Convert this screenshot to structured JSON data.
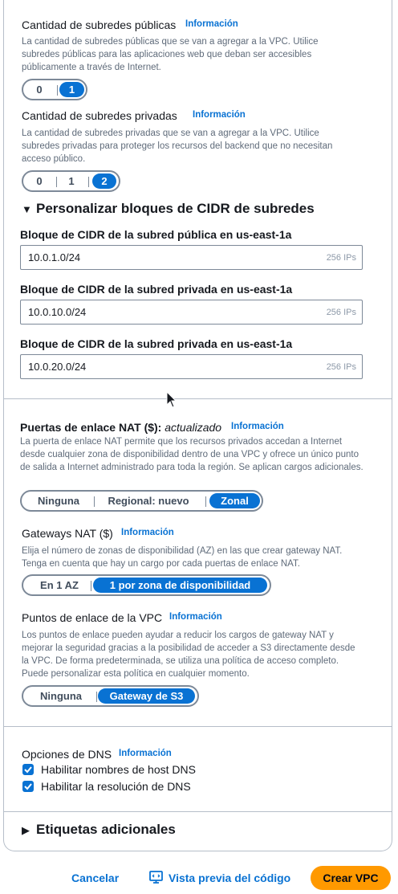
{
  "public_subnets": {
    "label": "Cantidad de subredes públicas",
    "info": "Información",
    "description": "La cantidad de subredes públicas que se van a agregar a la VPC. Utilice subredes públicas para las aplicaciones web que deban ser accesibles públicamente a través de Internet.",
    "options": [
      "0",
      "1"
    ],
    "selected": "1"
  },
  "private_subnets": {
    "label": "Cantidad de subredes privadas",
    "info": "Información",
    "description": "La cantidad de subredes privadas que se van a agregar a la VPC. Utilice subredes privadas para proteger los recursos del backend que no necesitan acceso público.",
    "options": [
      "0",
      "1",
      "2"
    ],
    "selected": "2"
  },
  "cidr_section": {
    "title": "Personalizar bloques de CIDR de subredes",
    "fields": [
      {
        "label": "Bloque de CIDR de la subred pública en us-east-1a",
        "value": "10.0.1.0/24",
        "suffix": "256 IPs"
      },
      {
        "label": "Bloque de CIDR de la subred privada en us-east-1a",
        "value": "10.0.10.0/24",
        "suffix": "256 IPs"
      },
      {
        "label": "Bloque de CIDR de la subred privada en us-east-1a",
        "value": "10.0.20.0/24",
        "suffix": "256 IPs"
      }
    ]
  },
  "nat_gateways": {
    "label": "Puertas de enlace NAT ($):",
    "label_em": "actualizado",
    "info": "Información",
    "description": "La puerta de enlace NAT permite que los recursos privados accedan a Internet desde cualquier zona de disponibilidad dentro de una VPC y ofrece un único punto de salida a Internet administrado para toda la región. Se aplican cargos adicionales.",
    "options": [
      "Ninguna",
      "Regional: nuevo",
      "Zonal"
    ],
    "selected": "Zonal"
  },
  "nat_gateways_count": {
    "label": "Gateways NAT ($)",
    "info": "Información",
    "description": "Elija el número de zonas de disponibilidad (AZ) en las que crear gateway NAT. Tenga en cuenta que hay un cargo por cada puertas de enlace NAT.",
    "options": [
      "En 1 AZ",
      "1 por zona de disponibilidad"
    ],
    "selected": "1 por zona de disponibilidad"
  },
  "vpc_endpoints": {
    "label": "Puntos de enlace de la VPC",
    "info": "Información",
    "description": "Los puntos de enlace pueden ayudar a reducir los cargos de gateway NAT y mejorar la seguridad gracias a la posibilidad de acceder a S3 directamente desde la VPC. De forma predeterminada, se utiliza una política de acceso completo. Puede personalizar esta política en cualquier momento.",
    "options": [
      "Ninguna",
      "Gateway de S3"
    ],
    "selected": "Gateway de S3"
  },
  "dns": {
    "label": "Opciones de DNS",
    "info": "Información",
    "options": [
      {
        "label": "Habilitar nombres de host DNS",
        "checked": true
      },
      {
        "label": "Habilitar la resolución de DNS",
        "checked": true
      }
    ]
  },
  "tags_section": {
    "title": "Etiquetas adicionales"
  },
  "footer": {
    "cancel": "Cancelar",
    "preview": "Vista previa del código",
    "create": "Crear VPC"
  },
  "colors": {
    "accent": "#0972d3",
    "primary_button": "#ff9900"
  }
}
